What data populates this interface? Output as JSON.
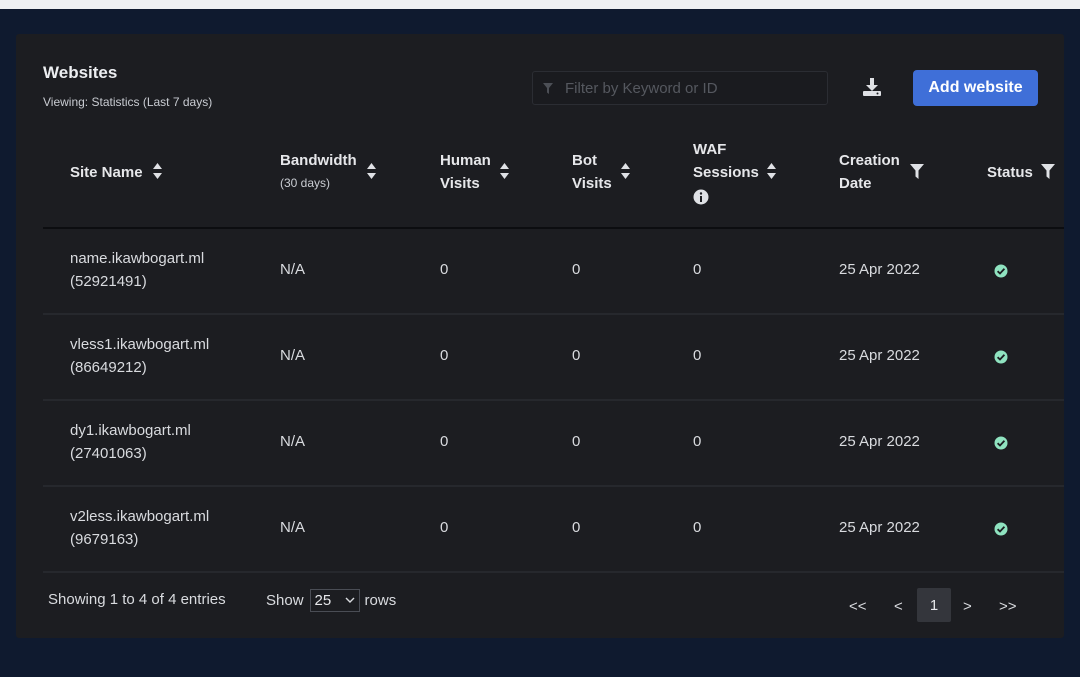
{
  "header": {
    "title": "Websites",
    "subtitle": "Viewing: Statistics (Last 7 days)",
    "filter_placeholder": "Filter by Keyword or ID",
    "add_button": "Add website"
  },
  "columns": {
    "site_name": "Site Name",
    "bandwidth": "Bandwidth",
    "bandwidth_note": "(30 days)",
    "human_l1": "Human",
    "human_l2": "Visits",
    "bot_l1": "Bot",
    "bot_l2": "Visits",
    "waf_l1": "WAF",
    "waf_l2": "Sessions",
    "creation_l1": "Creation",
    "creation_l2": "Date",
    "status": "Status"
  },
  "rows": [
    {
      "name": "name.ikawbogart.ml",
      "id": "(52921491)",
      "bandwidth": "N/A",
      "human": "0",
      "bot": "0",
      "waf": "0",
      "created": "25 Apr 2022",
      "status": "ok"
    },
    {
      "name": "vless1.ikawbogart.ml",
      "id": "(86649212)",
      "bandwidth": "N/A",
      "human": "0",
      "bot": "0",
      "waf": "0",
      "created": "25 Apr 2022",
      "status": "ok"
    },
    {
      "name": "dy1.ikawbogart.ml",
      "id": "(27401063)",
      "bandwidth": "N/A",
      "human": "0",
      "bot": "0",
      "waf": "0",
      "created": "25 Apr 2022",
      "status": "ok"
    },
    {
      "name": "v2less.ikawbogart.ml",
      "id": "(9679163)",
      "bandwidth": "N/A",
      "human": "0",
      "bot": "0",
      "waf": "0",
      "created": "25 Apr 2022",
      "status": "ok"
    }
  ],
  "footer": {
    "showing": "Showing 1 to 4 of 4 entries",
    "show_label": "Show",
    "rows_value": "25",
    "rows_label": "rows",
    "first": "<<",
    "prev": "<",
    "current_page": "1",
    "next": ">",
    "last": ">>"
  },
  "colors": {
    "background": "#0f1a2f",
    "panel": "#1c1d21",
    "accent": "#3f6fd8",
    "status_ok": "#8fe3c0"
  },
  "icons": {
    "filter": "filter-icon",
    "download": "download-icon",
    "sort": "sort-icon",
    "column_filter": "column-filter-icon",
    "info": "info-icon",
    "status": "check-circle-icon"
  }
}
